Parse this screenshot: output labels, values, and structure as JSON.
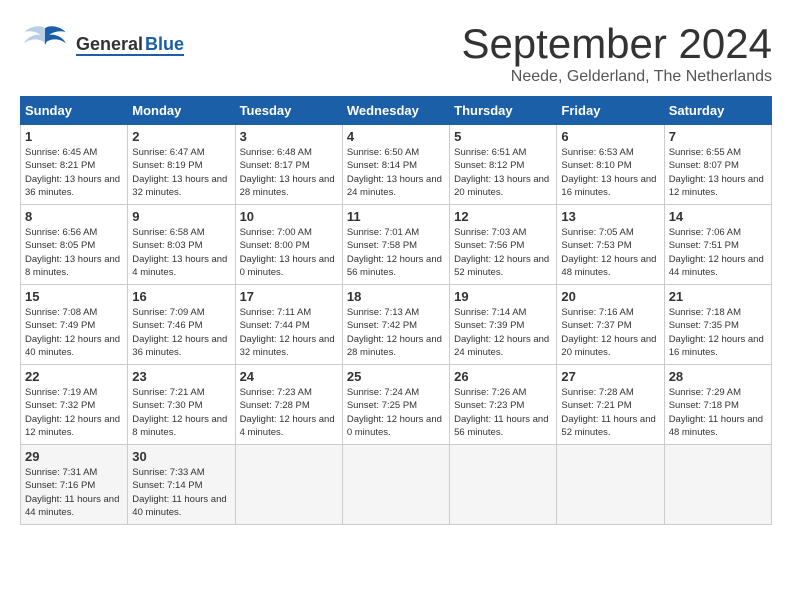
{
  "logo": {
    "general": "General",
    "blue": "Blue"
  },
  "title": {
    "month_year": "September 2024",
    "location": "Neede, Gelderland, The Netherlands"
  },
  "weekdays": [
    "Sunday",
    "Monday",
    "Tuesday",
    "Wednesday",
    "Thursday",
    "Friday",
    "Saturday"
  ],
  "weeks": [
    [
      {
        "day": "1",
        "sunrise": "Sunrise: 6:45 AM",
        "sunset": "Sunset: 8:21 PM",
        "daylight": "Daylight: 13 hours and 36 minutes."
      },
      {
        "day": "2",
        "sunrise": "Sunrise: 6:47 AM",
        "sunset": "Sunset: 8:19 PM",
        "daylight": "Daylight: 13 hours and 32 minutes."
      },
      {
        "day": "3",
        "sunrise": "Sunrise: 6:48 AM",
        "sunset": "Sunset: 8:17 PM",
        "daylight": "Daylight: 13 hours and 28 minutes."
      },
      {
        "day": "4",
        "sunrise": "Sunrise: 6:50 AM",
        "sunset": "Sunset: 8:14 PM",
        "daylight": "Daylight: 13 hours and 24 minutes."
      },
      {
        "day": "5",
        "sunrise": "Sunrise: 6:51 AM",
        "sunset": "Sunset: 8:12 PM",
        "daylight": "Daylight: 13 hours and 20 minutes."
      },
      {
        "day": "6",
        "sunrise": "Sunrise: 6:53 AM",
        "sunset": "Sunset: 8:10 PM",
        "daylight": "Daylight: 13 hours and 16 minutes."
      },
      {
        "day": "7",
        "sunrise": "Sunrise: 6:55 AM",
        "sunset": "Sunset: 8:07 PM",
        "daylight": "Daylight: 13 hours and 12 minutes."
      }
    ],
    [
      {
        "day": "8",
        "sunrise": "Sunrise: 6:56 AM",
        "sunset": "Sunset: 8:05 PM",
        "daylight": "Daylight: 13 hours and 8 minutes."
      },
      {
        "day": "9",
        "sunrise": "Sunrise: 6:58 AM",
        "sunset": "Sunset: 8:03 PM",
        "daylight": "Daylight: 13 hours and 4 minutes."
      },
      {
        "day": "10",
        "sunrise": "Sunrise: 7:00 AM",
        "sunset": "Sunset: 8:00 PM",
        "daylight": "Daylight: 13 hours and 0 minutes."
      },
      {
        "day": "11",
        "sunrise": "Sunrise: 7:01 AM",
        "sunset": "Sunset: 7:58 PM",
        "daylight": "Daylight: 12 hours and 56 minutes."
      },
      {
        "day": "12",
        "sunrise": "Sunrise: 7:03 AM",
        "sunset": "Sunset: 7:56 PM",
        "daylight": "Daylight: 12 hours and 52 minutes."
      },
      {
        "day": "13",
        "sunrise": "Sunrise: 7:05 AM",
        "sunset": "Sunset: 7:53 PM",
        "daylight": "Daylight: 12 hours and 48 minutes."
      },
      {
        "day": "14",
        "sunrise": "Sunrise: 7:06 AM",
        "sunset": "Sunset: 7:51 PM",
        "daylight": "Daylight: 12 hours and 44 minutes."
      }
    ],
    [
      {
        "day": "15",
        "sunrise": "Sunrise: 7:08 AM",
        "sunset": "Sunset: 7:49 PM",
        "daylight": "Daylight: 12 hours and 40 minutes."
      },
      {
        "day": "16",
        "sunrise": "Sunrise: 7:09 AM",
        "sunset": "Sunset: 7:46 PM",
        "daylight": "Daylight: 12 hours and 36 minutes."
      },
      {
        "day": "17",
        "sunrise": "Sunrise: 7:11 AM",
        "sunset": "Sunset: 7:44 PM",
        "daylight": "Daylight: 12 hours and 32 minutes."
      },
      {
        "day": "18",
        "sunrise": "Sunrise: 7:13 AM",
        "sunset": "Sunset: 7:42 PM",
        "daylight": "Daylight: 12 hours and 28 minutes."
      },
      {
        "day": "19",
        "sunrise": "Sunrise: 7:14 AM",
        "sunset": "Sunset: 7:39 PM",
        "daylight": "Daylight: 12 hours and 24 minutes."
      },
      {
        "day": "20",
        "sunrise": "Sunrise: 7:16 AM",
        "sunset": "Sunset: 7:37 PM",
        "daylight": "Daylight: 12 hours and 20 minutes."
      },
      {
        "day": "21",
        "sunrise": "Sunrise: 7:18 AM",
        "sunset": "Sunset: 7:35 PM",
        "daylight": "Daylight: 12 hours and 16 minutes."
      }
    ],
    [
      {
        "day": "22",
        "sunrise": "Sunrise: 7:19 AM",
        "sunset": "Sunset: 7:32 PM",
        "daylight": "Daylight: 12 hours and 12 minutes."
      },
      {
        "day": "23",
        "sunrise": "Sunrise: 7:21 AM",
        "sunset": "Sunset: 7:30 PM",
        "daylight": "Daylight: 12 hours and 8 minutes."
      },
      {
        "day": "24",
        "sunrise": "Sunrise: 7:23 AM",
        "sunset": "Sunset: 7:28 PM",
        "daylight": "Daylight: 12 hours and 4 minutes."
      },
      {
        "day": "25",
        "sunrise": "Sunrise: 7:24 AM",
        "sunset": "Sunset: 7:25 PM",
        "daylight": "Daylight: 12 hours and 0 minutes."
      },
      {
        "day": "26",
        "sunrise": "Sunrise: 7:26 AM",
        "sunset": "Sunset: 7:23 PM",
        "daylight": "Daylight: 11 hours and 56 minutes."
      },
      {
        "day": "27",
        "sunrise": "Sunrise: 7:28 AM",
        "sunset": "Sunset: 7:21 PM",
        "daylight": "Daylight: 11 hours and 52 minutes."
      },
      {
        "day": "28",
        "sunrise": "Sunrise: 7:29 AM",
        "sunset": "Sunset: 7:18 PM",
        "daylight": "Daylight: 11 hours and 48 minutes."
      }
    ],
    [
      {
        "day": "29",
        "sunrise": "Sunrise: 7:31 AM",
        "sunset": "Sunset: 7:16 PM",
        "daylight": "Daylight: 11 hours and 44 minutes."
      },
      {
        "day": "30",
        "sunrise": "Sunrise: 7:33 AM",
        "sunset": "Sunset: 7:14 PM",
        "daylight": "Daylight: 11 hours and 40 minutes."
      },
      null,
      null,
      null,
      null,
      null
    ]
  ]
}
